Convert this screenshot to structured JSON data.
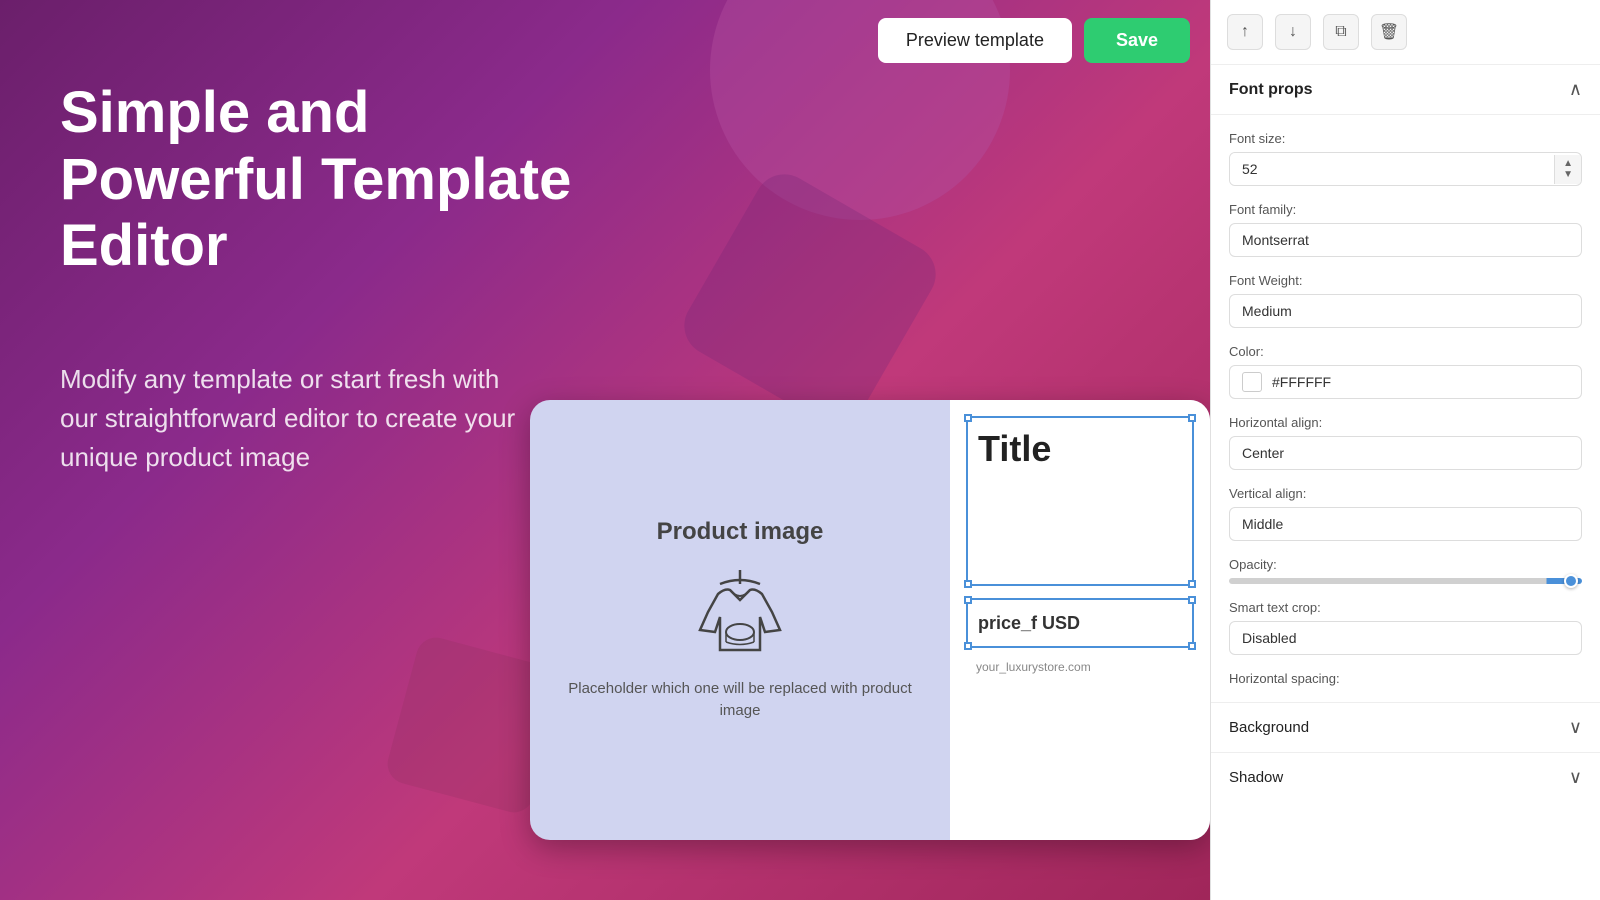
{
  "topbar": {
    "preview_label": "Preview template",
    "save_label": "Save"
  },
  "hero": {
    "title": "Simple and Powerful Template Editor",
    "subtitle": "Modify any template or start fresh with our straightforward editor to create your unique product image"
  },
  "template_card": {
    "product_image_label": "Product image",
    "placeholder_text": "Placeholder which one will be replaced with product image",
    "title_text": "Title",
    "price_text": "price_f USD",
    "url_text": "your_luxurystore.com"
  },
  "panel": {
    "toolbar": {
      "up_label": "↑",
      "down_label": "↓",
      "copy_label": "⧉",
      "delete_label": "🗑"
    },
    "font_props": {
      "section_title": "Font props",
      "font_size_label": "Font size:",
      "font_size_value": "52",
      "font_family_label": "Font family:",
      "font_family_value": "Montserrat",
      "font_weight_label": "Font Weight:",
      "font_weight_value": "Medium",
      "color_label": "Color:",
      "color_value": "#FFFFFF",
      "color_hex": "#FFFFFF",
      "horizontal_align_label": "Horizontal align:",
      "horizontal_align_value": "Center",
      "vertical_align_label": "Vertical align:",
      "vertical_align_value": "Middle",
      "opacity_label": "Opacity:",
      "smart_text_crop_label": "Smart text crop:",
      "smart_text_crop_value": "Disabled",
      "horizontal_spacing_label": "Horizontal spacing:"
    },
    "background_section": {
      "label": "Background"
    },
    "shadow_section": {
      "label": "Shadow"
    }
  }
}
